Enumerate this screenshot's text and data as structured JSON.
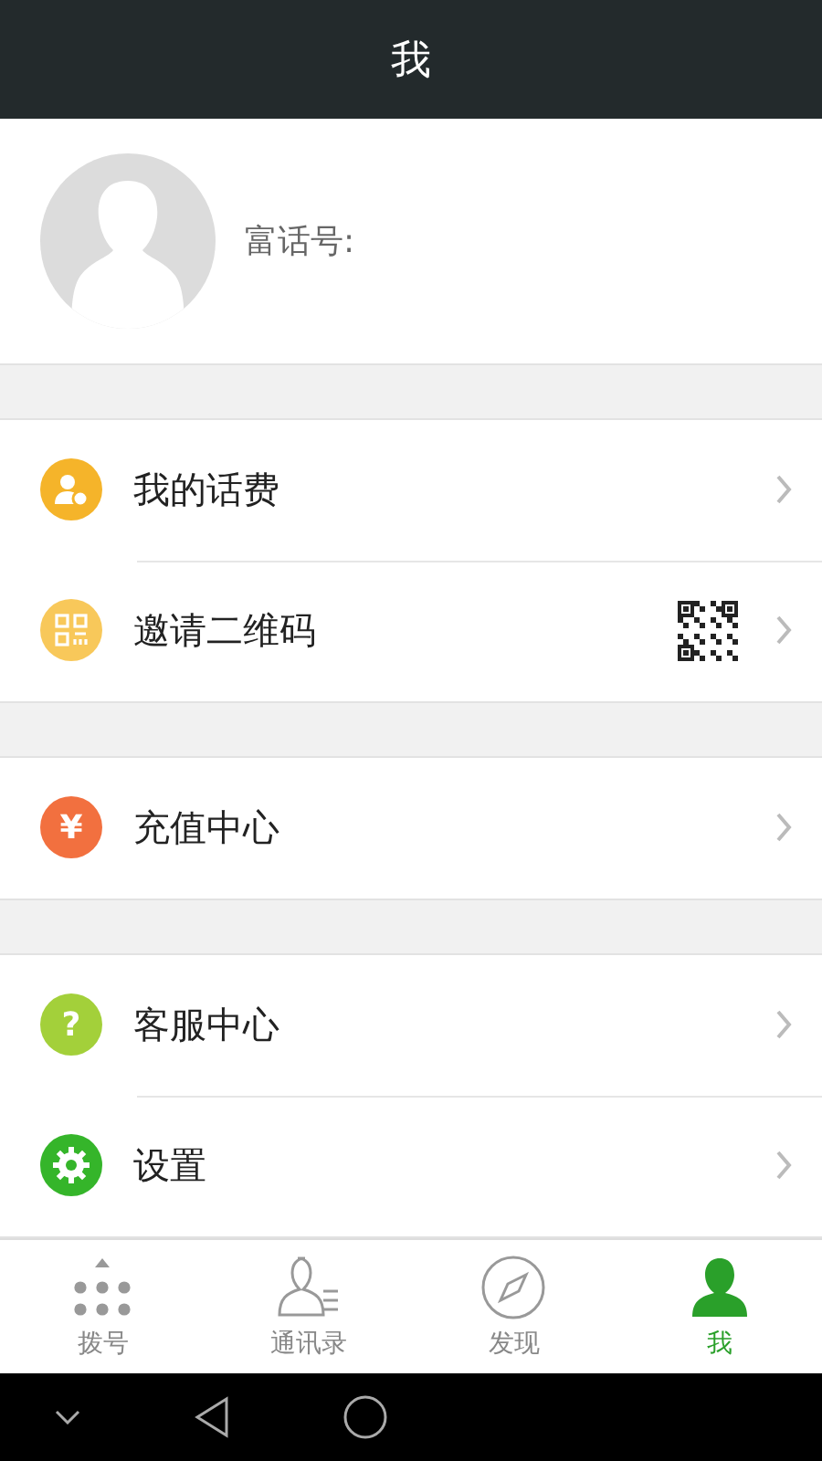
{
  "header": {
    "title": "我"
  },
  "profile": {
    "label": "富话号:"
  },
  "groups": [
    {
      "items": [
        {
          "kind": "balance",
          "label": "我的话费",
          "color": "#f5b42a",
          "qr_code": false
        },
        {
          "kind": "qr",
          "label": "邀请二维码",
          "color": "#f8c85a",
          "qr_code": true
        }
      ]
    },
    {
      "items": [
        {
          "kind": "glyph",
          "glyph": "¥",
          "label": "充值中心",
          "color": "#f2703f",
          "qr_code": false
        }
      ]
    },
    {
      "items": [
        {
          "kind": "glyph",
          "glyph": "?",
          "label": "客服中心",
          "color": "#a3d03a",
          "qr_code": false
        },
        {
          "kind": "gear",
          "label": "设置",
          "color": "#35b52a",
          "qr_code": false
        }
      ]
    }
  ],
  "tabs": [
    {
      "kind": "dialpad",
      "label": "拨号",
      "selected": false
    },
    {
      "kind": "contacts",
      "label": "通讯录",
      "selected": false
    },
    {
      "kind": "compass",
      "label": "发现",
      "selected": false
    },
    {
      "kind": "person",
      "label": "我",
      "selected": true
    }
  ]
}
